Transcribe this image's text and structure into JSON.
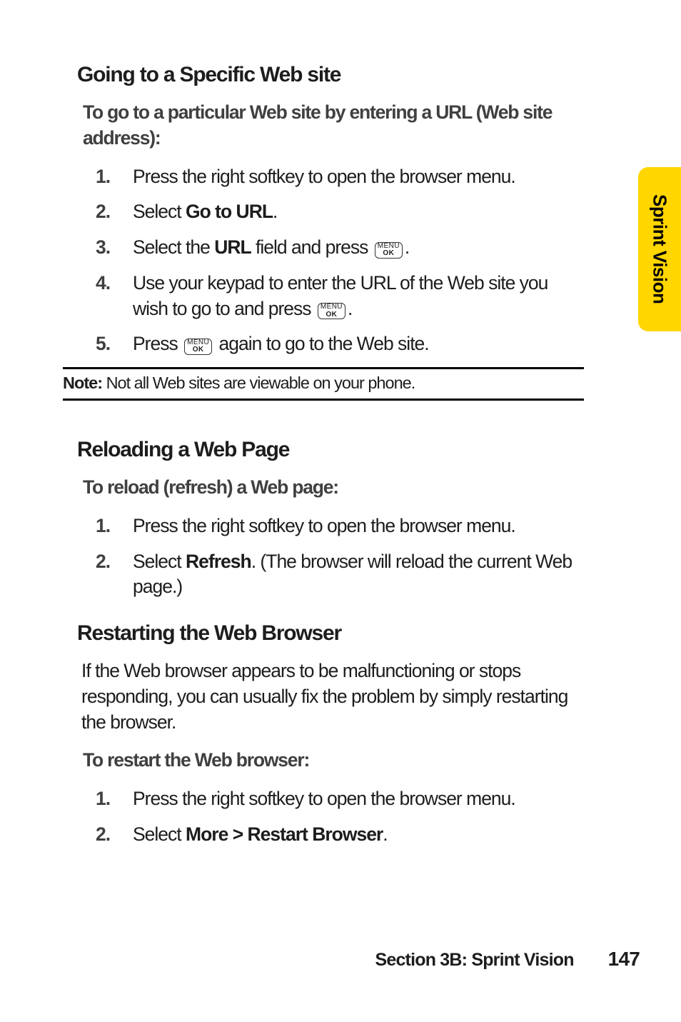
{
  "tab": {
    "label": "Sprint Vision"
  },
  "sections": {
    "goto": {
      "heading": "Going to a Specific Web site",
      "lead": "To go to a particular Web site by entering a URL (Web site address):",
      "steps": {
        "s1": {
          "num": "1.",
          "text": "Press the right softkey to open the browser menu."
        },
        "s2": {
          "num": "2.",
          "pre": "Select ",
          "bold": "Go to URL",
          "post": "."
        },
        "s3": {
          "num": "3.",
          "pre": "Select the ",
          "bold": "URL",
          "mid": " field and press ",
          "post": "."
        },
        "s4": {
          "num": "4.",
          "pre": "Use your keypad to enter the URL of the Web site you wish to go to and press ",
          "post": "."
        },
        "s5": {
          "num": "5.",
          "pre": "Press ",
          "mid": " again to go to the Web site."
        }
      },
      "note": {
        "label": "Note:",
        "text": " Not all Web sites are viewable on your phone."
      }
    },
    "reload": {
      "heading": "Reloading a Web Page",
      "lead": "To reload (refresh) a Web page:",
      "steps": {
        "s1": {
          "num": "1.",
          "text": "Press the right softkey to open the browser menu."
        },
        "s2": {
          "num": "2.",
          "pre": "Select ",
          "bold": "Refresh",
          "post": ". (The browser will reload the current Web page.)"
        }
      }
    },
    "restart": {
      "heading": "Restarting the Web Browser",
      "para": "If the Web browser appears to be malfunctioning or stops responding, you can usually fix the problem by simply restarting the browser.",
      "lead": "To restart the Web browser:",
      "steps": {
        "s1": {
          "num": "1.",
          "text": "Press the right softkey to open the browser menu."
        },
        "s2": {
          "num": "2.",
          "pre": "Select ",
          "bold": "More > Restart Browser",
          "post": "."
        }
      }
    }
  },
  "menuok": {
    "top": "MENU",
    "bottom": "OK"
  },
  "footer": {
    "section": "Section 3B: Sprint Vision",
    "page": "147"
  }
}
